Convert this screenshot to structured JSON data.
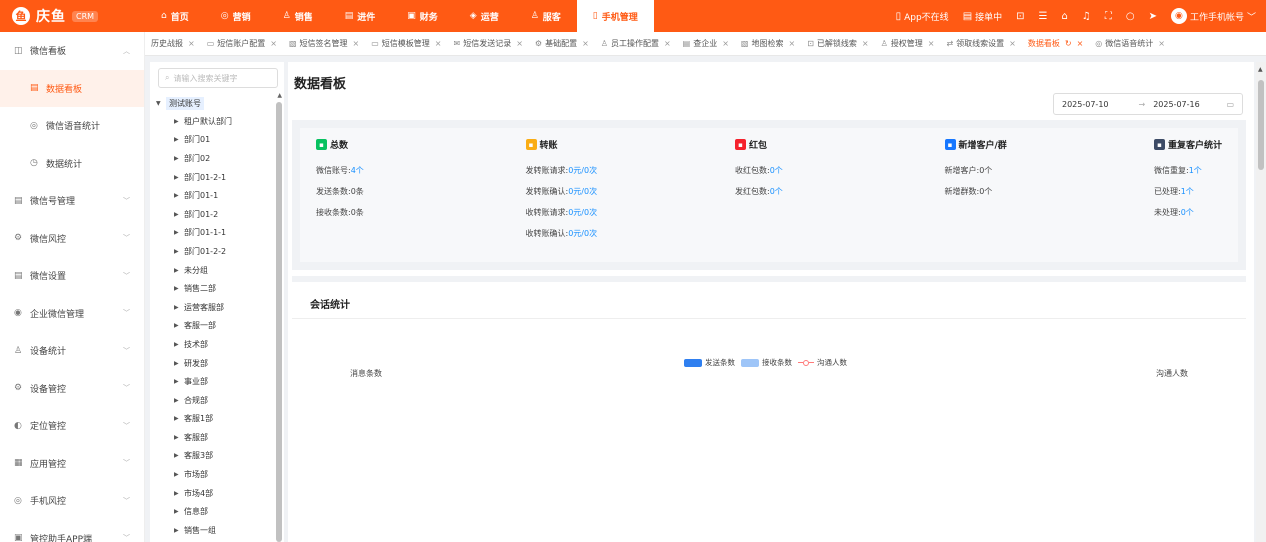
{
  "brand": {
    "name": "庆鱼",
    "badge": "CRM",
    "mark": "鱼"
  },
  "topnav": [
    {
      "icon": "⌂",
      "label": "首页"
    },
    {
      "icon": "◎",
      "label": "营销"
    },
    {
      "icon": "♙",
      "label": "销售"
    },
    {
      "icon": "▤",
      "label": "进件"
    },
    {
      "icon": "▣",
      "label": "财务"
    },
    {
      "icon": "◈",
      "label": "运营"
    },
    {
      "icon": "♙",
      "label": "服客"
    },
    {
      "icon": "▯",
      "label": "手机管理"
    }
  ],
  "topright": {
    "app_status": "App不在线",
    "queue": "接单中",
    "account": "工作手机帐号"
  },
  "sidebar": [
    {
      "icon": "◫",
      "label": "微信看板",
      "chev": "︿"
    },
    {
      "icon": "▤",
      "label": "数据看板"
    },
    {
      "icon": "◎",
      "label": "微信语音统计"
    },
    {
      "icon": "◷",
      "label": "数据统计"
    },
    {
      "icon": "▤",
      "label": "微信号管理",
      "chev": "﹀"
    },
    {
      "icon": "⚙",
      "label": "微信风控",
      "chev": "﹀"
    },
    {
      "icon": "▤",
      "label": "微信设置",
      "chev": "﹀"
    },
    {
      "icon": "◉",
      "label": "企业微信管理",
      "chev": "﹀"
    },
    {
      "icon": "♙",
      "label": "设备统计",
      "chev": "﹀"
    },
    {
      "icon": "⚙",
      "label": "设备管控",
      "chev": "﹀"
    },
    {
      "icon": "◐",
      "label": "定位管控",
      "chev": "﹀"
    },
    {
      "icon": "▦",
      "label": "应用管控",
      "chev": "﹀"
    },
    {
      "icon": "◎",
      "label": "手机风控",
      "chev": "﹀"
    },
    {
      "icon": "▣",
      "label": "管控助手APP端",
      "chev": "﹀"
    }
  ],
  "tabs": [
    {
      "label": "历史战报",
      "icon": "",
      "close": "×"
    },
    {
      "label": "短信账户配置",
      "icon": "▭",
      "close": "×"
    },
    {
      "label": "短信签名管理",
      "icon": "▧",
      "close": "×"
    },
    {
      "label": "短信模板管理",
      "icon": "▭",
      "close": "×"
    },
    {
      "label": "短信发送记录",
      "icon": "✉",
      "close": "×"
    },
    {
      "label": "基础配置",
      "icon": "⚙",
      "close": "×"
    },
    {
      "label": "员工操作配置",
      "icon": "♙",
      "close": "×"
    },
    {
      "label": "查企业",
      "icon": "▤",
      "close": "×"
    },
    {
      "label": "地图检索",
      "icon": "▧",
      "close": "×"
    },
    {
      "label": "已解锁线索",
      "icon": "⊡",
      "close": "×"
    },
    {
      "label": "授权管理",
      "icon": "♙",
      "close": "×"
    },
    {
      "label": "领取线索设置",
      "icon": "⇄",
      "close": "×"
    },
    {
      "label": "数据看板",
      "icon": "",
      "close": "×",
      "refresh": "↻"
    },
    {
      "label": "微信语音统计",
      "icon": "◎",
      "close": "×"
    }
  ],
  "tree": {
    "search_placeholder": "请输入搜索关键字",
    "search_icon": "⌕",
    "root": "测试账号",
    "nodes": [
      "租户默认部门",
      "部门01",
      "部门02",
      "部门01-2-1",
      "部门01-1",
      "部门01-2",
      "部门01-1-1",
      "部门01-2-2",
      "未分组",
      "销售二部",
      "运营客服部",
      "客服一部",
      "技术部",
      "研发部",
      "事业部",
      "合规部",
      "客服1部",
      "客服部",
      "客服3部",
      "市场部",
      "市场4部",
      "信息部",
      "销售一组"
    ]
  },
  "main": {
    "title": "数据看板",
    "date_start": "2025-07-10",
    "date_sep": "→",
    "date_end": "2025-07-16",
    "date_icon": "▭"
  },
  "stats": [
    {
      "icon": "▪",
      "color": "#07c160",
      "title": "总数",
      "lines": [
        {
          "k": "微信账号:",
          "v": "4个"
        },
        {
          "k": "发送条数:",
          "v": "0条",
          "plain": true
        },
        {
          "k": "接收条数:",
          "v": "0条",
          "plain": true
        }
      ]
    },
    {
      "icon": "▪",
      "color": "#faad14",
      "title": "转账",
      "lines": [
        {
          "k": "发转账请求:",
          "v": "0元/0次"
        },
        {
          "k": "发转账确认:",
          "v": "0元/0次"
        },
        {
          "k": "收转账请求:",
          "v": "0元/0次"
        },
        {
          "k": "收转账确认:",
          "v": "0元/0次"
        }
      ]
    },
    {
      "icon": "▪",
      "color": "#f5222d",
      "title": "红包",
      "lines": [
        {
          "k": "收红包数:",
          "v": "0个"
        },
        {
          "k": "发红包数:",
          "v": "0个"
        }
      ]
    },
    {
      "icon": "▪",
      "color": "#1677ff",
      "title": "新增客户/群",
      "lines": [
        {
          "k": "新增客户:",
          "v": "0个",
          "plain": true
        },
        {
          "k": "新增群数:",
          "v": "0个",
          "plain": true
        }
      ]
    },
    {
      "icon": "▪",
      "color": "#3d4b66",
      "title": "重复客户统计",
      "lines": [
        {
          "k": "微信重复:",
          "v": "1个"
        },
        {
          "k": "已处理:",
          "v": "1个"
        },
        {
          "k": "未处理:",
          "v": "0个"
        }
      ]
    }
  ],
  "conversation": {
    "title": "会话统计",
    "y_left": "消息条数",
    "y_right": "沟通人数",
    "legend": [
      {
        "label": "发送条数",
        "color": "#2f7ff0",
        "kind": "bar"
      },
      {
        "label": "接收条数",
        "color": "#9ec5f8",
        "kind": "bar"
      },
      {
        "label": "沟通人数",
        "color": "#ff7a7a",
        "kind": "line"
      }
    ]
  }
}
